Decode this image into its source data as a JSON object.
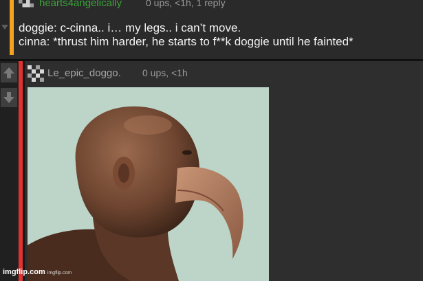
{
  "comment1": {
    "username": "hearts4angelically",
    "meta": "0 ups, <1h, 1 reply",
    "lines": [
      "doggie: c-cinna.. i… my legs.. i can’t move.",
      "cinna: *thrust him harder, he starts to f**k doggie until he fainted*"
    ]
  },
  "comment2": {
    "username": "Le_epic_doggo.",
    "meta": "0 ups, <1h"
  },
  "watermark": {
    "main": "imgflip.com",
    "sub": "imgflip.com"
  },
  "colors": {
    "username1": "#3aa538",
    "thread_bar1": "#f6a21e",
    "thread_bar2": "#e0322f"
  },
  "icons": [
    "pixel-avatar-icon",
    "upvote-arrow-icon",
    "downvote-arrow-icon"
  ]
}
